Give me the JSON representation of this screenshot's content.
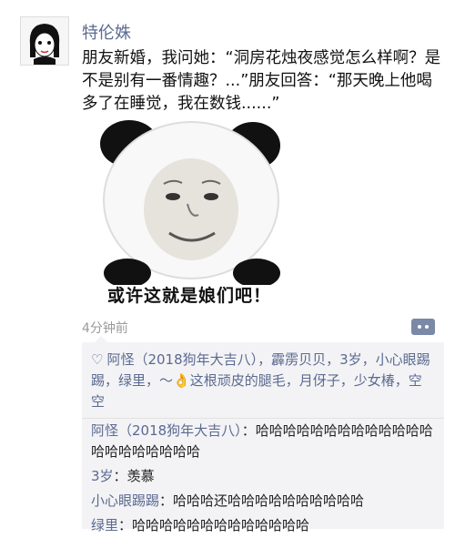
{
  "post": {
    "username": "特伦姝",
    "text": "朋友新婚，我问她：“洞房花烛夜感觉怎么样啊？是不是别有一番情趣？...”朋友回答：“那天晚上他喝多了在睡觉，我在数钱......”",
    "meme_caption": "或许这就是娘们吧！",
    "timestamp": "4分钟前"
  },
  "likes": {
    "icon": "heart-outline-icon",
    "before_emoji": "阿怪（2018狗年大吉八），霹雳贝贝，3岁，小心眼踢踢，绿里，～",
    "emoji": "👌",
    "after_emoji": "这根顽皮的腿毛，月伢子，少女椿，空空"
  },
  "comments": [
    {
      "name": "阿怪（2018狗年大吉八）",
      "sep": "：",
      "text": "哈哈哈哈哈哈哈哈哈哈哈哈哈哈哈哈哈哈哈哈哈"
    },
    {
      "name": "3岁",
      "sep": "：",
      "text": "羡慕"
    },
    {
      "name": "小心眼踢踢",
      "sep": "：",
      "text": "哈哈哈还哈哈哈哈哈哈哈哈哈哈"
    },
    {
      "name": "绿里",
      "sep": "：",
      "text": "哈哈哈哈哈哈哈哈哈哈哈哈哈"
    }
  ],
  "colors": {
    "name_link": "#5b6a91",
    "comment_bg": "#f3f3f5",
    "timestamp": "#9a9a9a"
  }
}
